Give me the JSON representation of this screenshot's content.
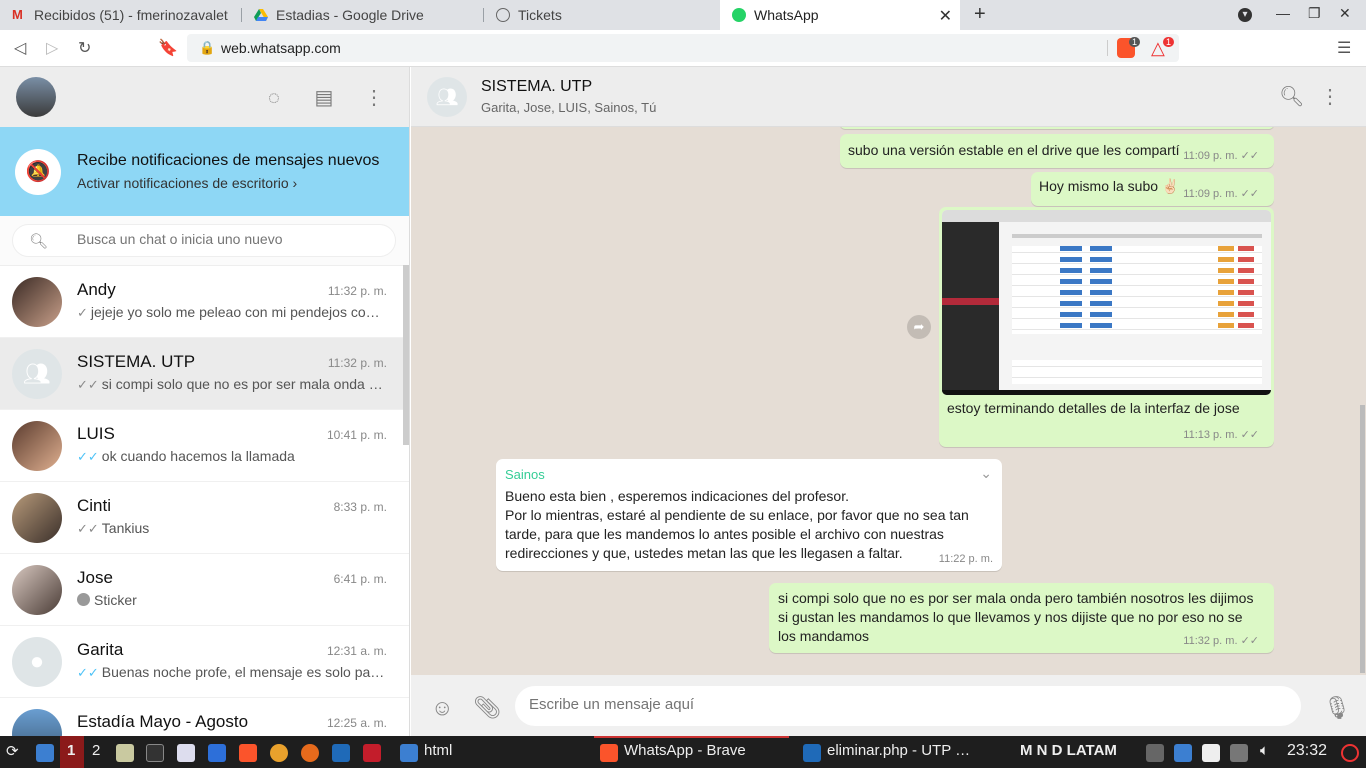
{
  "browser": {
    "tabs": [
      {
        "label": "Recibidos (51) - fmerinozavalet",
        "icon": "gmail-icon"
      },
      {
        "label": "Estadias - Google Drive",
        "icon": "drive-icon"
      },
      {
        "label": "Tickets",
        "icon": "globe-icon"
      },
      {
        "label": "WhatsApp",
        "icon": "whatsapp-icon"
      }
    ],
    "url": "web.whatsapp.com",
    "badges": {
      "brave": "1",
      "rewards": "1"
    }
  },
  "notification": {
    "title": "Recibe notificaciones de mensajes nuevos",
    "subtitle": "Activar notificaciones de escritorio ›"
  },
  "search": {
    "placeholder": "Busca un chat o inicia uno nuevo"
  },
  "chats": [
    {
      "name": "Andy",
      "time": "11:32 p. m.",
      "tick": "✓",
      "message": "jejeje yo solo me peleao con mi pendejos co…"
    },
    {
      "name": "SISTEMA. UTP",
      "time": "11:32 p. m.",
      "tick": "✓✓",
      "message": "si compi solo que no es por ser mala onda …"
    },
    {
      "name": "LUIS",
      "time": "10:41 p. m.",
      "tick": "✓✓",
      "message": "ok cuando hacemos la llamada"
    },
    {
      "name": "Cinti",
      "time": "8:33 p. m.",
      "tick": "✓✓",
      "message": "Tankius"
    },
    {
      "name": "Jose",
      "time": "6:41 p. m.",
      "tick": "",
      "message": "Sticker"
    },
    {
      "name": "Garita",
      "time": "12:31 a. m.",
      "tick": "✓✓",
      "message": "Buenas noche profe, el mensaje es solo pa…"
    },
    {
      "name": "Estadía Mayo - Agosto",
      "time": "12:25 a. m.",
      "tick": "",
      "message": ""
    }
  ],
  "conversation": {
    "title": "SISTEMA. UTP",
    "members": "Garita, Jose, LUIS, Sainos, Tú",
    "messages": {
      "m1": {
        "text": "subo una versión estable en el drive que les compartí",
        "time": "11:09 p. m."
      },
      "m2": {
        "text": "Hoy mismo la subo ✌🏻",
        "time": "11:09 p. m."
      },
      "m3": {
        "text": "estoy terminando detalles de la interfaz de jose",
        "time": "11:13 p. m."
      },
      "m4": {
        "sender": "Sainos",
        "line1": "Bueno esta bien , esperemos indicaciones del profesor.",
        "line2": "Por lo mientras, estaré al pendiente de su enlace, por favor que no sea tan tarde, para que les mandemos lo antes posible el archivo con nuestras redirecciones y que, ustedes metan las que les llegasen a faltar.",
        "time": "11:22 p. m."
      },
      "m5": {
        "text": "si compi solo que no es por ser mala onda pero también nosotros les dijimos si gustan les mandamos lo que llevamos y nos dijiste que no por eso no se los mandamos",
        "time": "11:32 p. m."
      }
    },
    "tick": "✓✓",
    "compose_placeholder": "Escribe un mensaje aquí"
  },
  "taskbar": {
    "ws1": "1",
    "ws2": "2",
    "html": "html",
    "whatsapp": "WhatsApp - Brave",
    "vscode": "eliminar.php - UTP …",
    "kb": "M N D LATAM",
    "clock": "23:32"
  },
  "colors": {
    "accent": "#00bfa5",
    "notification": "#8ed7f5",
    "outgoing": "#dcf8c6"
  }
}
